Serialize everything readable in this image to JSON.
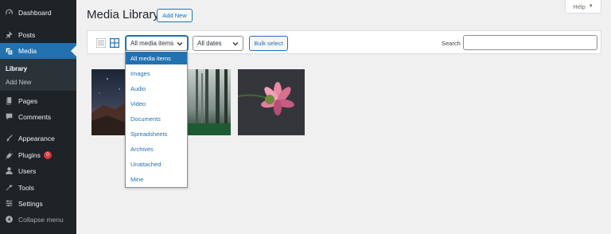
{
  "sidebar": {
    "items": [
      {
        "label": "Dashboard",
        "icon": "dashboard-icon"
      },
      {
        "label": "Posts",
        "icon": "pin-icon"
      },
      {
        "label": "Media",
        "icon": "media-icon"
      },
      {
        "label": "Pages",
        "icon": "pages-icon"
      },
      {
        "label": "Comments",
        "icon": "comment-icon"
      },
      {
        "label": "Appearance",
        "icon": "brush-icon"
      },
      {
        "label": "Plugins",
        "icon": "plugin-icon",
        "badge": "0"
      },
      {
        "label": "Users",
        "icon": "user-icon"
      },
      {
        "label": "Tools",
        "icon": "wrench-icon"
      },
      {
        "label": "Settings",
        "icon": "settings-icon"
      }
    ],
    "submenu": [
      {
        "label": "Library"
      },
      {
        "label": "Add New"
      }
    ],
    "collapse_label": "Collapse menu"
  },
  "header": {
    "title": "Media Library",
    "add_new_label": "Add New",
    "help_label": "Help"
  },
  "toolbar": {
    "type_filter": "All media items",
    "date_filter": "All dates",
    "bulk_select_label": "Bulk select",
    "search_label": "Search",
    "search_value": ""
  },
  "dropdown": {
    "options": [
      "All media items",
      "Images",
      "Audio",
      "Video",
      "Documents",
      "Spreadsheets",
      "Archives",
      "Unattached",
      "Mine"
    ],
    "selected": "All media items"
  },
  "media": [
    {
      "subject": "night-sky-rocks-photo"
    },
    {
      "subject": "misty-forest-photo"
    },
    {
      "subject": "pink-flower-photo"
    }
  ],
  "colors": {
    "sidebar": "#1d2327",
    "accent": "#2271b1",
    "background": "#f0f0f1",
    "badge": "#d63638"
  }
}
